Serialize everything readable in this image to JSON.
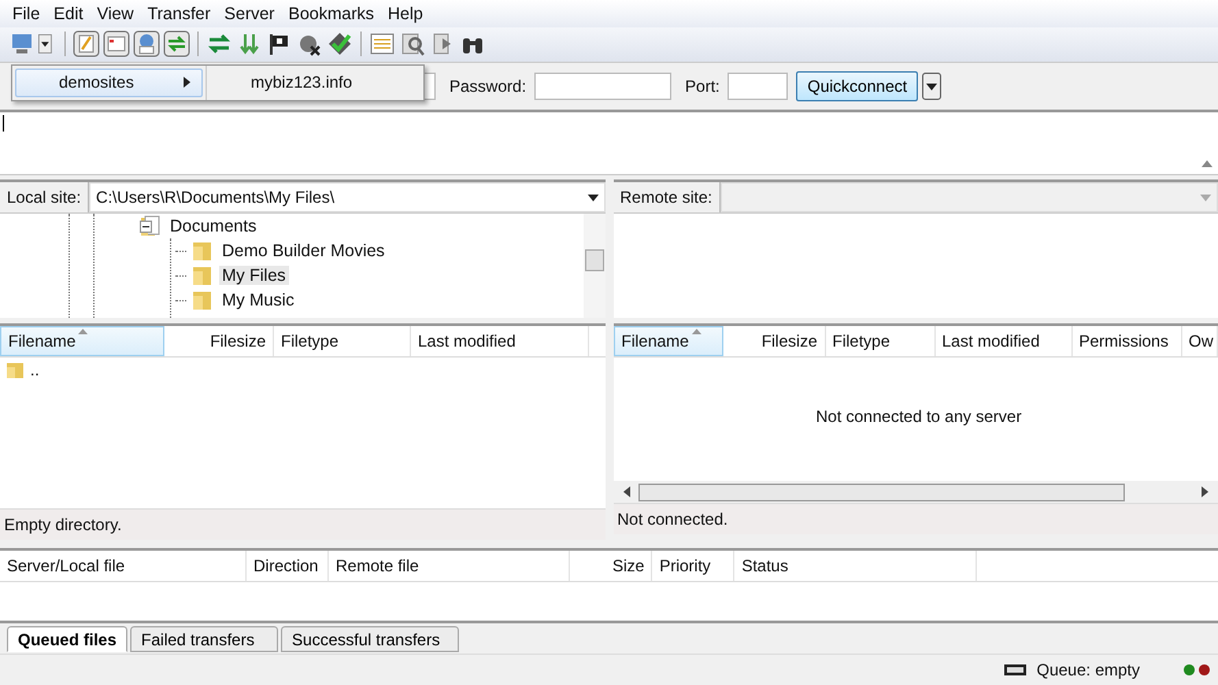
{
  "menu_bar": [
    {
      "label": "File"
    },
    {
      "label": "Edit"
    },
    {
      "label": "View"
    },
    {
      "label": "Transfer"
    },
    {
      "label": "Server"
    },
    {
      "label": "Bookmarks"
    },
    {
      "label": "Help"
    }
  ],
  "site_menu": {
    "items": [
      {
        "label": "demosites",
        "selected": true,
        "submenu": true
      }
    ],
    "submenu_items": [
      "mybiz123.info"
    ]
  },
  "quickconnect": {
    "password_label": "Password:",
    "port_label": "Port:",
    "button": "Quickconnect"
  },
  "local_site": {
    "label": "Local site:",
    "path": "C:\\Users\\R\\Documents\\My Files\\",
    "tree": [
      {
        "label": "Documents",
        "expanded": true,
        "selected": false,
        "children": [
          {
            "label": "Demo Builder Movies",
            "selected": false
          },
          {
            "label": "My Files",
            "selected": true
          },
          {
            "label": "My Music",
            "selected": false
          }
        ]
      }
    ]
  },
  "remote_site": {
    "label": "Remote site:"
  },
  "local_files": {
    "columns": [
      {
        "label": "Filename",
        "sorted": true
      },
      {
        "label": "Filesize",
        "sorted": false
      },
      {
        "label": "Filetype",
        "sorted": false
      },
      {
        "label": "Last modified",
        "sorted": false
      }
    ],
    "rows": [
      {
        "name": ".."
      }
    ],
    "status": "Empty directory."
  },
  "remote_files": {
    "columns": [
      {
        "label": "Filename",
        "sorted": true
      },
      {
        "label": "Filesize",
        "sorted": false
      },
      {
        "label": "Filetype",
        "sorted": false
      },
      {
        "label": "Last modified",
        "sorted": false
      },
      {
        "label": "Permissions",
        "sorted": false
      },
      {
        "label": "Ow",
        "sorted": false
      }
    ],
    "empty_message": "Not connected to any server",
    "status": "Not connected."
  },
  "queue": {
    "columns": [
      "Server/Local file",
      "Direction",
      "Remote file",
      "Size",
      "Priority",
      "Status"
    ]
  },
  "queue_tabs": [
    {
      "label": "Queued files",
      "selected": true
    },
    {
      "label": "Failed transfers",
      "selected": false
    },
    {
      "label": "Successful transfers",
      "selected": false
    }
  ],
  "status_bar": {
    "queue": "Queue: empty",
    "lights": [
      {
        "color": "#1f8a1f"
      },
      {
        "color": "#a01818"
      }
    ]
  }
}
